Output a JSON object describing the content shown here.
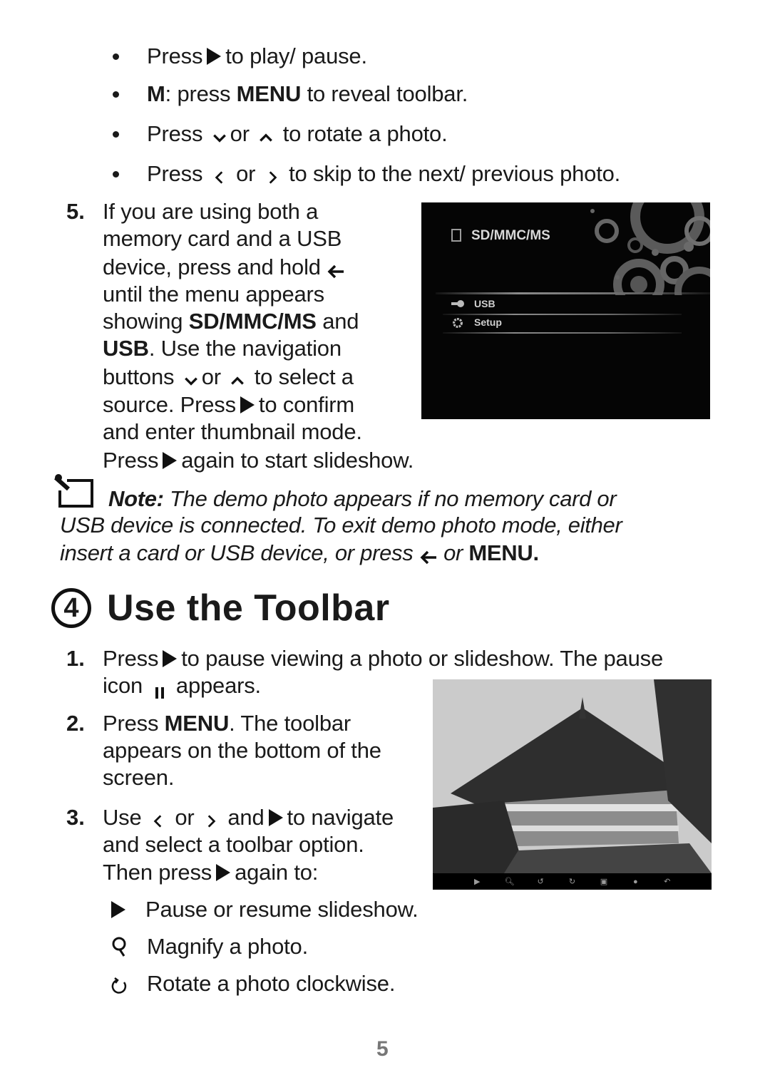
{
  "bullets": [
    {
      "parts": [
        "Press",
        "play-icon",
        "to play/ pause."
      ]
    },
    {
      "bold_prefix": "M",
      "text_a": ": press ",
      "bold_mid": "MENU",
      "text_b": " to reveal toolbar."
    },
    {
      "parts": [
        "Press",
        "chevron-down-icon",
        "or",
        "chevron-up-icon",
        "to rotate a photo."
      ]
    },
    {
      "parts": [
        "Press",
        "chevron-left-icon",
        "or",
        "chevron-right-icon",
        "to skip to the next/ previous photo."
      ]
    }
  ],
  "b1": {
    "press": "Press",
    "text": "to play/ pause."
  },
  "b2": {
    "m": "M",
    "colon": ": press ",
    "menu": "MENU",
    "rest": " to reveal toolbar."
  },
  "b3": {
    "press": "Press",
    "or": "or",
    "rest": "to rotate a photo."
  },
  "b4": {
    "press": "Press",
    "or": "or",
    "rest": "to skip to the next/ previous photo."
  },
  "step5": {
    "number": "5.",
    "l1": "If you are using both a",
    "l2": "memory card and a USB",
    "l3": "device, press and hold",
    "l4": "until the menu appears",
    "l5a": "showing ",
    "l5b": "SD/MMC/MS",
    "l5c": " and",
    "l6a": "USB",
    "l6b": ". Use the navigation",
    "l7a": "buttons",
    "l7or": "or",
    "l7b": "to select a",
    "l8a": "source. Press",
    "l8b": "to confirm",
    "l9": "and enter thumbnail mode.",
    "l10a": "Press",
    "l10b": "again to start slideshow."
  },
  "screen_menu": {
    "title": "SD/MMC/MS",
    "items": [
      {
        "icon": "usb-icon",
        "label": "USB"
      },
      {
        "icon": "gear-icon",
        "label": "Setup"
      }
    ]
  },
  "note": {
    "label": "Note:",
    "l1": " The demo photo appears if no memory card or",
    "l2": "USB device is connected. To exit demo photo mode, either",
    "l3a": "insert a card or USB device, or press",
    "l3b": "or",
    "l3c": "MENU."
  },
  "section": {
    "number": "4",
    "title": "Use the Toolbar"
  },
  "steps": {
    "s1": {
      "number": "1.",
      "a": "Press",
      "b": "to pause viewing a photo or slideshow. The pause",
      "c": "icon",
      "d": "appears."
    },
    "s2": {
      "number": "2.",
      "a": "Press ",
      "menu": "MENU",
      "b": ". The toolbar",
      "l2": "appears on the bottom of the",
      "l3": "screen."
    },
    "s3": {
      "number": "3.",
      "a": "Use",
      "or": "or",
      "and": "and",
      "b": "to navigate",
      "l2": "and select a toolbar option.",
      "l3a": "Then press",
      "l3b": "again to:"
    }
  },
  "options": [
    {
      "icon": "play-icon",
      "label": "Pause or resume slideshow."
    },
    {
      "icon": "magnify-icon",
      "label": "Magnify a photo."
    },
    {
      "icon": "rotate-clockwise-icon",
      "label": "Rotate a photo clockwise."
    }
  ],
  "toolbar_icons": [
    "play-icon",
    "zoom-icon",
    "rotate-left-icon",
    "rotate-right-icon",
    "photo-icon",
    "settings-icon",
    "back-icon"
  ],
  "page_number": "5"
}
